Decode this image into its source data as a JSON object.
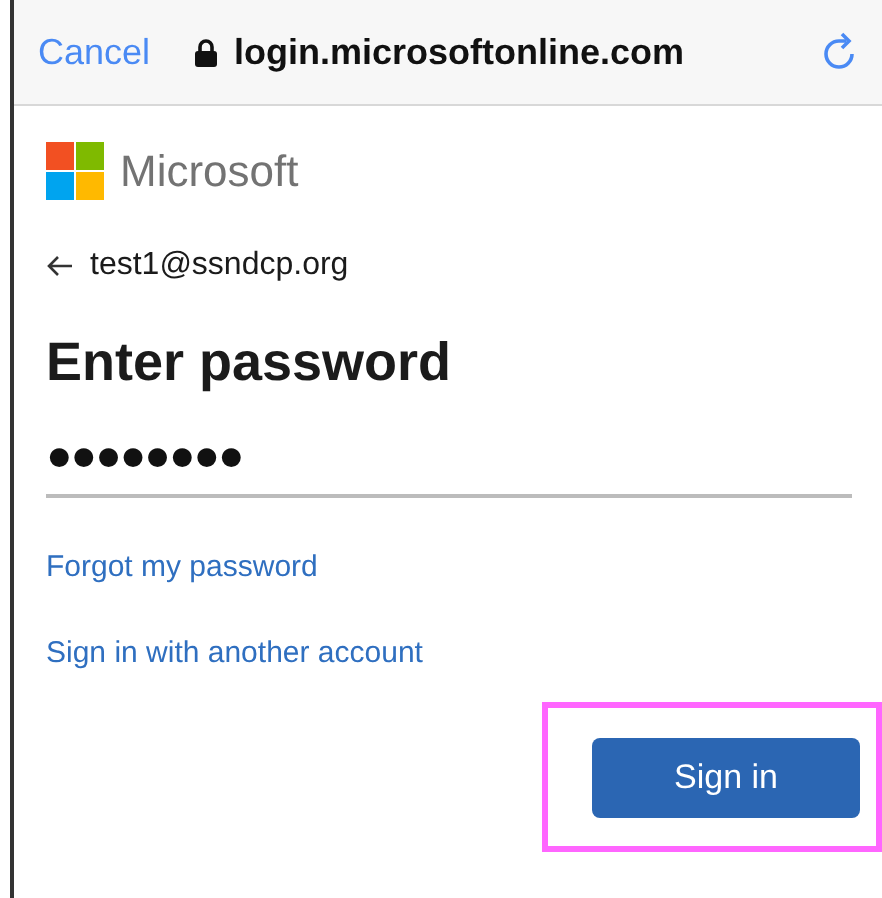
{
  "browser_bar": {
    "cancel": "Cancel",
    "address": "login.microsoftonline.com"
  },
  "brand": {
    "name": "Microsoft"
  },
  "account": {
    "email": "test1@ssndcp.org"
  },
  "heading": "Enter password",
  "password_field": {
    "value": "●●●●●●●●"
  },
  "links": [
    "Forgot my password",
    "Sign in with another account"
  ],
  "sign_in_button": {
    "label": "Sign in",
    "highlighted": true
  }
}
